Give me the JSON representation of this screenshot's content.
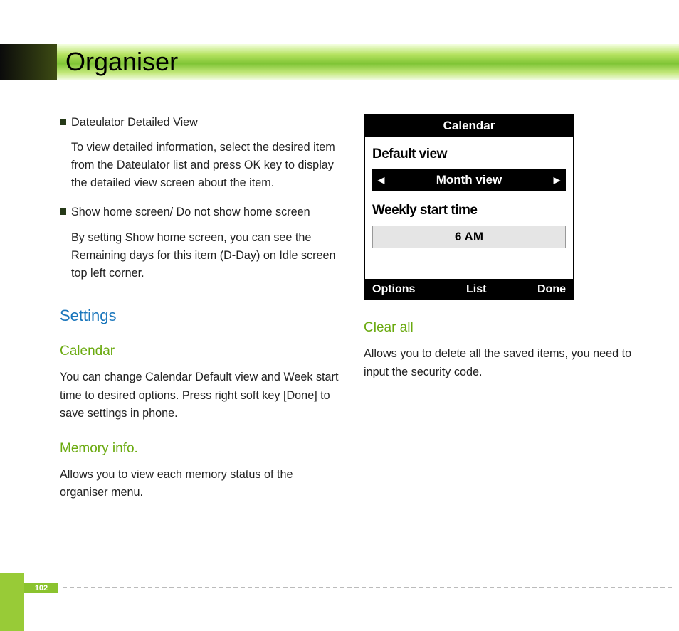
{
  "pageTitle": "Organiser",
  "pageNumber": "102",
  "leftColumn": {
    "bullets": [
      {
        "title": "Dateulator Detailed View",
        "body": "To view detailed information, select the desired item from the Dateulator list and press OK key to display the detailed view screen about the item."
      },
      {
        "title": "Show home screen/ Do not show home screen",
        "body": "By setting Show home screen, you can see the Remaining days for this item (D-Day) on Idle screen top left corner."
      }
    ],
    "settingsHeading": "Settings",
    "sections": [
      {
        "title": "Calendar",
        "body": "You can change Calendar Default view and Week start time to desired options. Press right soft key [Done] to save settings in phone."
      },
      {
        "title": "Memory info.",
        "body": "Allows you to view each memory status of the organiser menu."
      }
    ]
  },
  "rightColumn": {
    "clearAll": {
      "title": "Clear all",
      "body": "Allows you to delete all the saved items, you need to input the security code."
    }
  },
  "phone": {
    "title": "Calendar",
    "defaultViewLabel": "Default view",
    "defaultViewValue": "Month view",
    "weeklyStartLabel": "Weekly start time",
    "weeklyStartValue": "6 AM",
    "softLeft": "Options",
    "softCenter": "List",
    "softRight": "Done"
  }
}
